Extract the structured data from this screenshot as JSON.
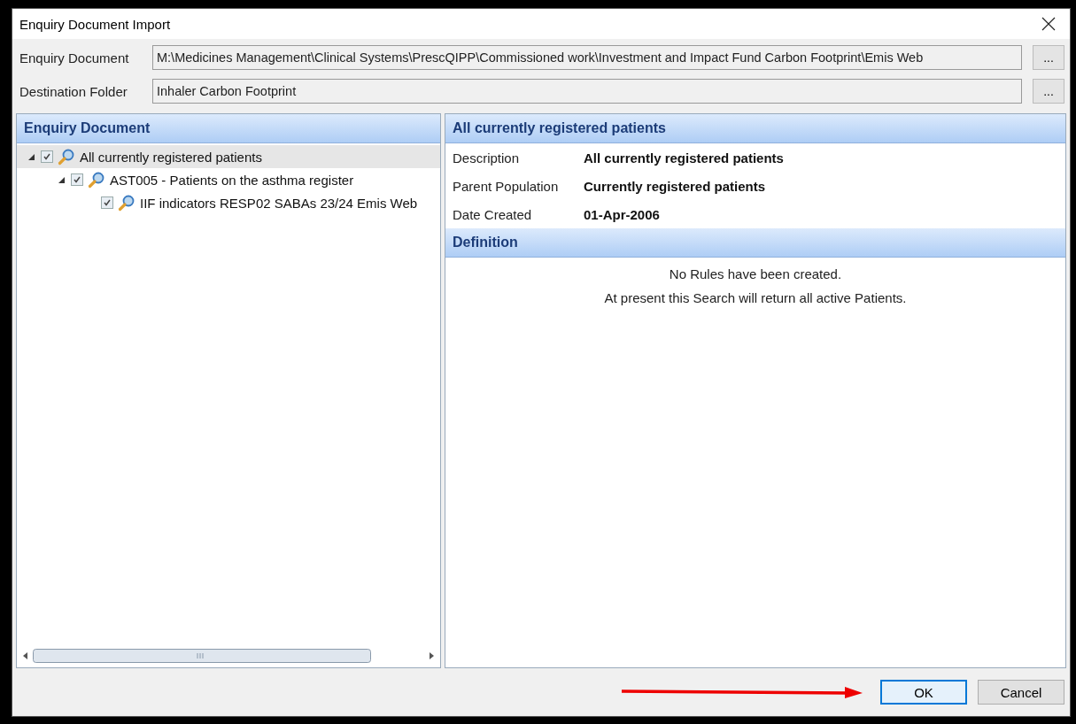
{
  "window": {
    "title": "Enquiry Document Import"
  },
  "fields": [
    {
      "label": "Enquiry Document",
      "value": "M:\\Medicines Management\\Clinical Systems\\PrescQIPP\\Commissioned work\\Investment and Impact Fund Carbon Footprint\\Emis Web",
      "button": "..."
    },
    {
      "label": "Destination Folder",
      "value": "Inhaler Carbon Footprint",
      "button": "..."
    }
  ],
  "tree": {
    "title": "Enquiry Document",
    "items": [
      {
        "label": "All currently registered patients",
        "checked": true,
        "expanded": true,
        "selected": true,
        "children": [
          {
            "label": "AST005 - Patients on the asthma register",
            "checked": true,
            "expanded": true,
            "selected": false,
            "children": [
              {
                "label": "IIF indicators RESP02 SABAs 23/24 Emis Web",
                "checked": true,
                "selected": false
              }
            ]
          }
        ]
      }
    ]
  },
  "details": {
    "title": "All currently registered patients",
    "properties": [
      {
        "label": "Description",
        "value": "All currently registered patients"
      },
      {
        "label": "Parent Population",
        "value": "Currently registered patients"
      },
      {
        "label": "Date Created",
        "value": "01-Apr-2006"
      }
    ],
    "definition_title": "Definition",
    "messages": [
      "No Rules have been created.",
      "At present this Search will return all active Patients."
    ]
  },
  "buttons": [
    {
      "label": "OK",
      "selected": true
    },
    {
      "label": "Cancel",
      "selected": false
    }
  ]
}
